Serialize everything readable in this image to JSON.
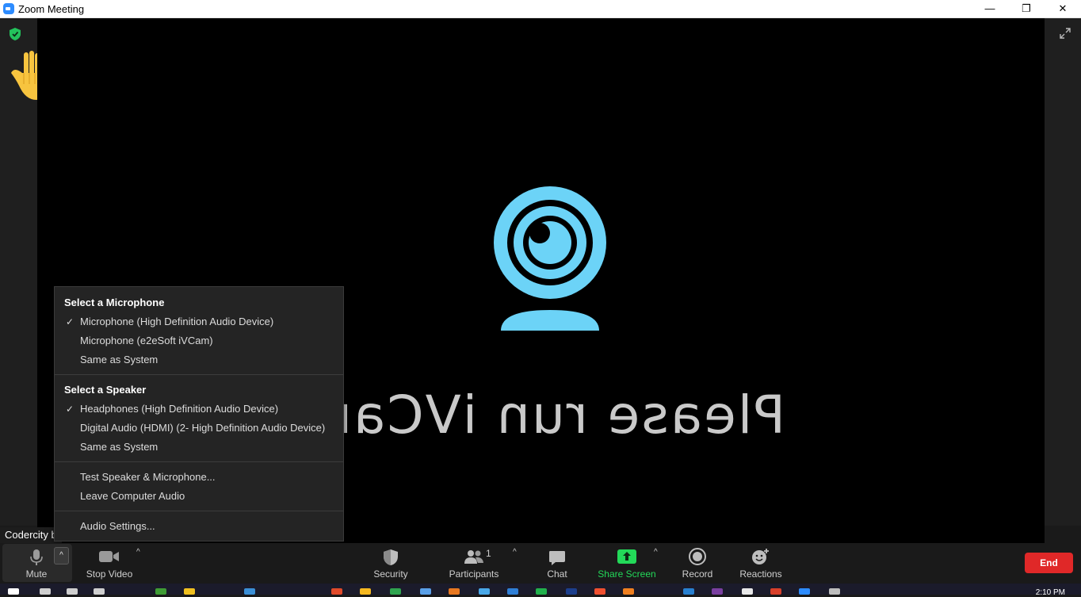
{
  "window": {
    "title": "Zoom Meeting",
    "minimize": "—",
    "restore": "❐",
    "close": "✕"
  },
  "video": {
    "mirrored_text": "Please run iVCam"
  },
  "participant": {
    "name_tag": "Codercity b"
  },
  "audio_menu": {
    "microphone_heading": "Select a Microphone",
    "microphones": [
      {
        "label": "Microphone (High Definition Audio Device)",
        "checked": true
      },
      {
        "label": "Microphone (e2eSoft iVCam)",
        "checked": false
      },
      {
        "label": "Same as System",
        "checked": false
      }
    ],
    "speaker_heading": "Select a Speaker",
    "speakers": [
      {
        "label": "Headphones (High Definition Audio Device)",
        "checked": true
      },
      {
        "label": "Digital Audio (HDMI) (2- High Definition Audio Device)",
        "checked": false
      },
      {
        "label": "Same as System",
        "checked": false
      }
    ],
    "test_label": "Test Speaker & Microphone...",
    "leave_label": "Leave Computer Audio",
    "settings_label": "Audio Settings...",
    "check_glyph": "✓"
  },
  "toolbar": {
    "mute": "Mute",
    "stop_video": "Stop Video",
    "security": "Security",
    "participants": "Participants",
    "participants_count": "1",
    "chat": "Chat",
    "share_screen": "Share Screen",
    "record": "Record",
    "reactions": "Reactions",
    "end": "End",
    "caret": "^"
  },
  "taskbar": {
    "clock": "2:10 PM"
  },
  "colors": {
    "accent_blue": "#2d8cff",
    "share_green": "#23d959",
    "end_red": "#e02828",
    "webcam_blue": "#6cd3f7"
  },
  "icons": [
    "zoom-logo-icon",
    "shield-icon",
    "raise-hand-icon",
    "expand-icon",
    "webcam-icon",
    "microphone-icon",
    "video-camera-icon",
    "security-shield-icon",
    "participants-icon",
    "chat-icon",
    "share-screen-icon",
    "record-icon",
    "reactions-icon"
  ]
}
